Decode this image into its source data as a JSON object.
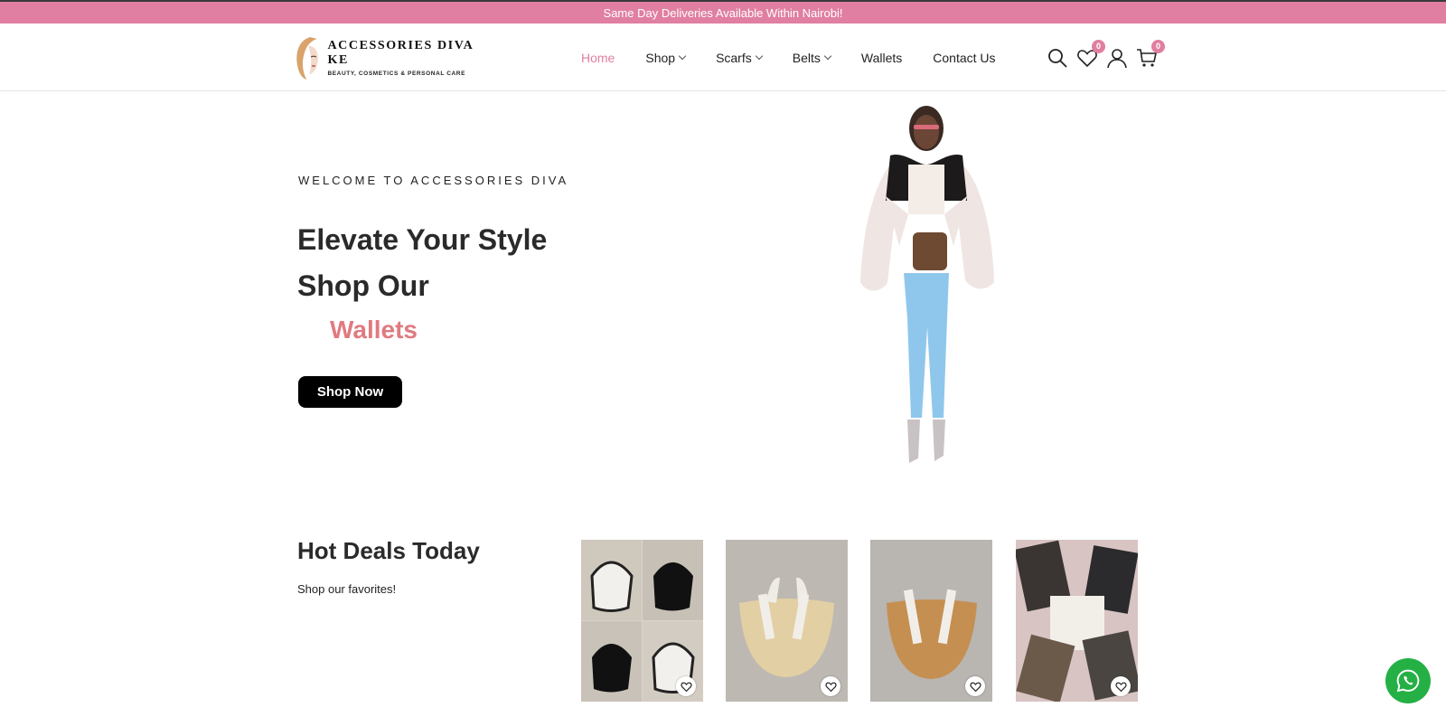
{
  "announcement": "Same Day Deliveries Available Within Nairobi!",
  "logo": {
    "title": "ACCESSORIES DIVA KE",
    "tagline": "BEAUTY, COSMETICS & PERSONAL CARE"
  },
  "nav": {
    "home": "Home",
    "shop": "Shop",
    "scarfs": "Scarfs",
    "belts": "Belts",
    "wallets": "Wallets",
    "contact": "Contact Us"
  },
  "header_icons": {
    "search": "search-icon",
    "wishlist_count": "0",
    "account": "user-icon",
    "cart_count": "0"
  },
  "hero": {
    "kicker": "WELCOME TO ACCESSORIES DIVA",
    "headline_line1": "Elevate Your Style",
    "headline_line2": "Shop Our",
    "accent": "Wallets",
    "cta": "Shop Now"
  },
  "deals": {
    "title": "Hot Deals Today",
    "subtitle": "Shop our favorites!",
    "products": [
      {
        "image": "chloe-black-white-bags"
      },
      {
        "image": "chloe-straw-bag-natural"
      },
      {
        "image": "chloe-straw-bag-tan"
      },
      {
        "image": "lv-monogram-wallets"
      }
    ]
  },
  "colors": {
    "accent": "#e07fa1",
    "accent_text": "#e07a80",
    "cta_bg": "#000000",
    "whatsapp": "#25b046"
  }
}
